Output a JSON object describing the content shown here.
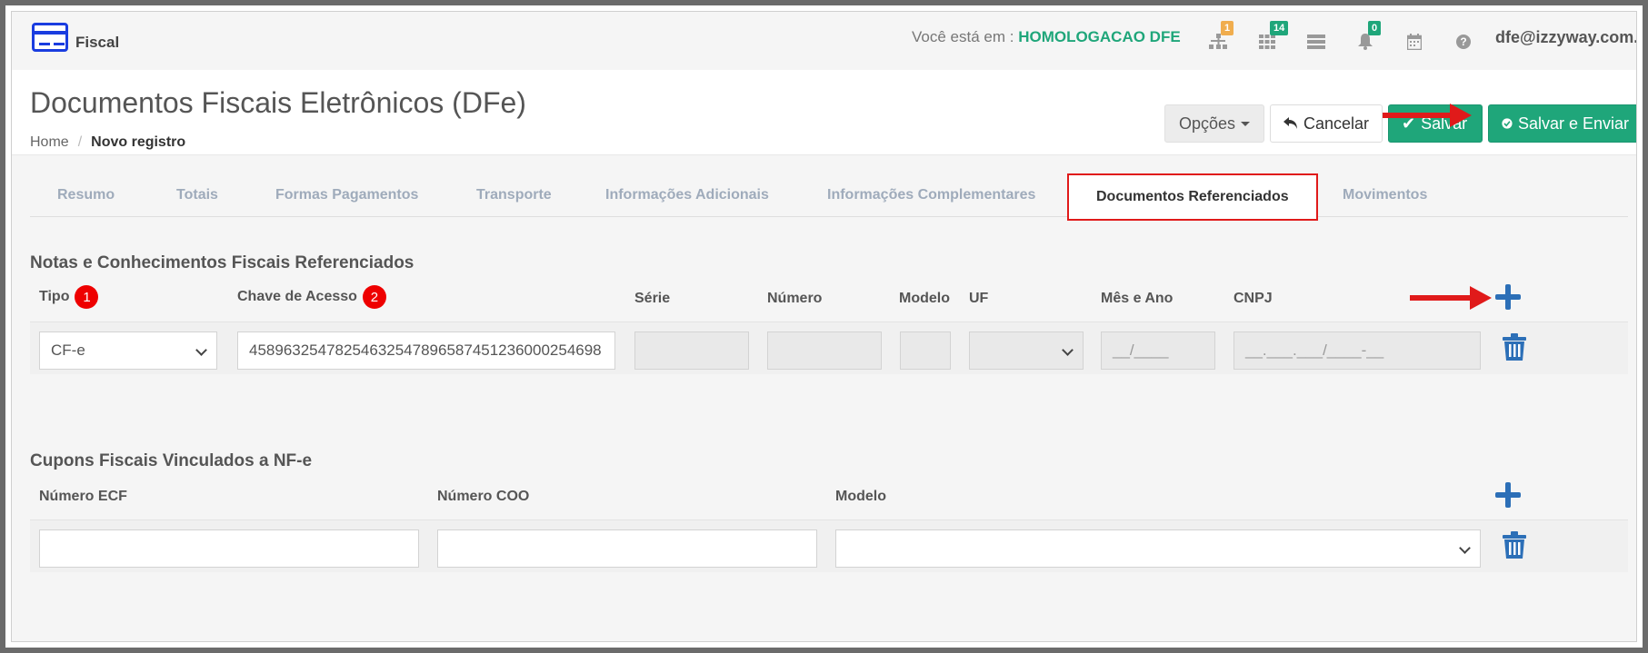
{
  "topbar": {
    "module_label": "Fiscal",
    "env_prefix": "Você está em :",
    "env_value": "HOMOLOGACAO DFE",
    "icons": [
      {
        "name": "sitemap-icon",
        "badge": "1"
      },
      {
        "name": "grid-icon",
        "badge": "14"
      },
      {
        "name": "server-icon",
        "badge": ""
      },
      {
        "name": "bell-icon",
        "badge": "0"
      },
      {
        "name": "calendar-icon",
        "badge": ""
      },
      {
        "name": "help-icon",
        "badge": ""
      }
    ],
    "user_email": "dfe@izzyway.com.br"
  },
  "header": {
    "title": "Documentos Fiscais Eletrônicos (DFe)",
    "breadcrumb": [
      "Home",
      "/",
      "Novo registro"
    ],
    "actions": {
      "options_label": "Opções",
      "cancel_label": "Cancelar",
      "save_label": "Salvar",
      "save_send_label": "Salvar e Enviar"
    }
  },
  "tabs": [
    "Resumo",
    "Totais",
    "Formas Pagamentos",
    "Transporte",
    "Informações Adicionais",
    "Informações Complementares",
    "Documentos Referenciados",
    "Movimentos"
  ],
  "active_tab": "Documentos Referenciados",
  "notas_section": {
    "title": "Notas e Conhecimentos Fiscais Referenciados",
    "columns": [
      "Tipo",
      "Chave de Acesso",
      "Série",
      "Número",
      "Modelo",
      "UF",
      "Mês e Ano",
      "CNPJ"
    ],
    "markers": {
      "tipo": "1",
      "chave": "2"
    },
    "row": {
      "tipo": "CF-e",
      "chave": "45896325478254632547896587451236000254698",
      "serie": "",
      "numero": "",
      "modelo": "",
      "uf": "",
      "mes_ano_placeholder": "__/____",
      "cnpj_placeholder": "__.___.___/____-__"
    }
  },
  "cupons_section": {
    "title": "Cupons Fiscais Vinculados a NF-e",
    "columns": [
      "Número ECF",
      "Número COO",
      "Modelo"
    ],
    "row": {
      "ecf": "",
      "coo": "",
      "modelo": ""
    }
  },
  "colors": {
    "accent_green": "#1fa67a",
    "annotation_red": "#e01a1a",
    "icon_blue": "#2c6fb7"
  }
}
